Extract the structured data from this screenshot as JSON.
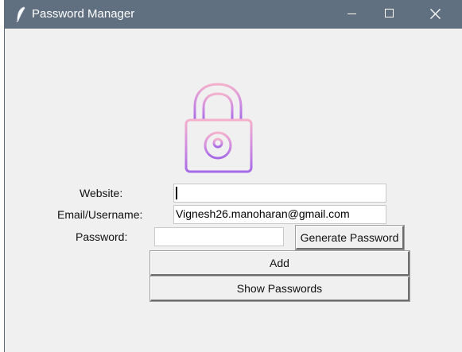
{
  "window": {
    "title": "Password Manager",
    "title_icon": "feather-icon",
    "controls": {
      "minimize": "minimize-icon",
      "maximize": "maximize-icon",
      "close": "close-icon"
    }
  },
  "logo": {
    "icon": "padlock-icon",
    "colors": [
      "#f2a8c8",
      "#c084e8",
      "#a66ee6"
    ]
  },
  "form": {
    "website_label": "Website:",
    "website_value": "",
    "email_label": "Email/Username:",
    "email_value": "Vignesh26.manoharan@gmail.com",
    "password_label": "Password:",
    "password_value": ""
  },
  "buttons": {
    "generate_label": "Generate Password",
    "add_label": "Add",
    "show_label": "Show Passwords"
  },
  "colors": {
    "titlebar": "#607080",
    "window_bg": "#f0f0f0"
  }
}
